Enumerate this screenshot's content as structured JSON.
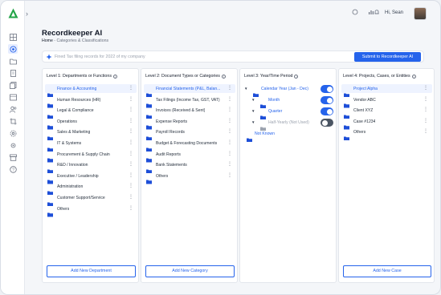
{
  "app": {
    "title": "Recordkeeper AI",
    "accent": "#2563eb"
  },
  "breadcrumb": {
    "home": "Home",
    "sep": " - ",
    "current": "Categories & Classifications"
  },
  "header": {
    "greeting": "Hi, Sean"
  },
  "search": {
    "placeholder": "Fined Tax filing records for 2022 of my company",
    "submit_label": "Submit to Recordkeeper AI"
  },
  "col1": {
    "title": "Level 1: Departments or Functions",
    "items": [
      "Finance & Accounting",
      "Human Resources (HR)",
      "Legal & Compliance",
      "Operations",
      "Sales & Marketing",
      "IT & Systems",
      "Procurement & Supply Chain",
      "R&D / Innovation",
      "Executive / Leadership",
      "Administration",
      "Customer Support/Service",
      "Others"
    ],
    "add_label": "Add New Department"
  },
  "col2": {
    "title": "Level 2: Document Types or Categories",
    "items": [
      "Financial Statements (P&L, Balan...",
      "Tax Filings (Income Tax, GST, VAT)",
      "Invoices (Received & Sent)",
      "Expense Reports",
      "Payroll Records",
      "Budget & Forecasting Documents",
      "Audit Reports",
      "Bank Statements",
      "Others"
    ],
    "add_label": "Add New Category"
  },
  "col3": {
    "title": "Level 3: Year/Time Period",
    "items": [
      {
        "label": "Calendar Year (Jan - Dec)",
        "on": true
      },
      {
        "label": "Month",
        "on": true
      },
      {
        "label": "Quarter",
        "on": true
      },
      {
        "label": "Half-Yearly (Not Used)",
        "on": false
      }
    ],
    "not_known": "Not Known"
  },
  "col4": {
    "title": "Level 4: Projects, Cases, or Entities",
    "items": [
      "Project Alpha",
      "Vendor ABC",
      "Client XYZ",
      "Case #1234",
      "Others"
    ],
    "add_label": "Add New Case"
  }
}
